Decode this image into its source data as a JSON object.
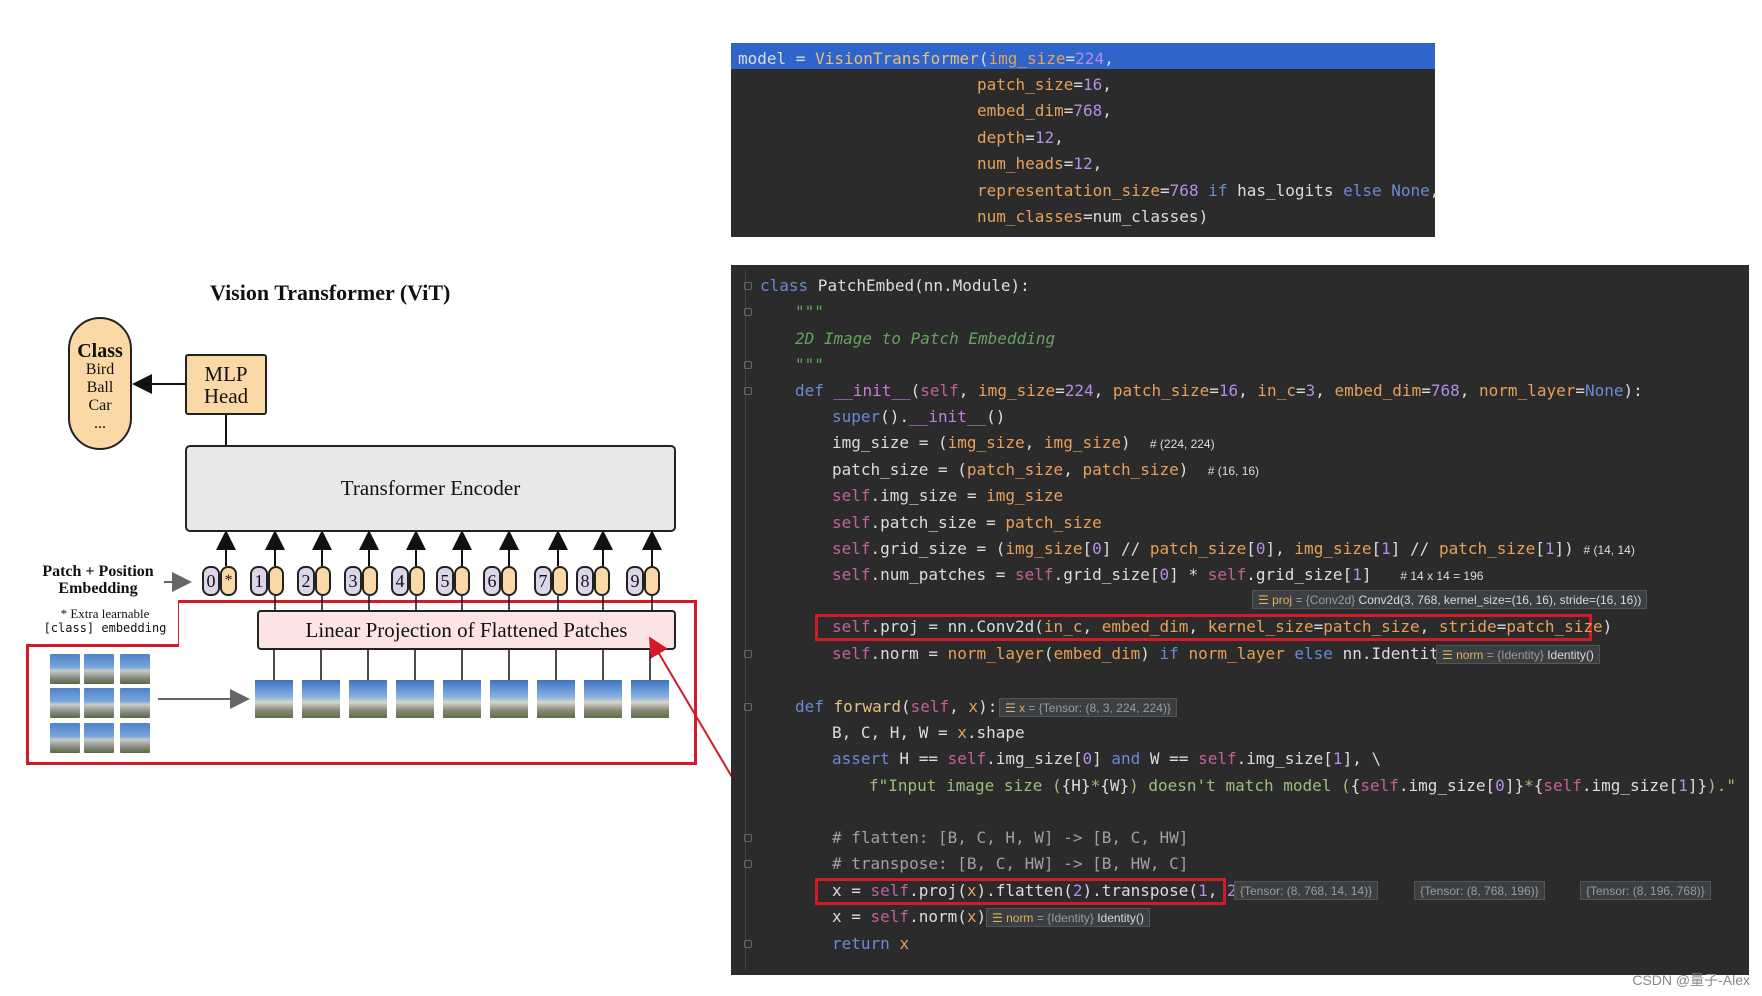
{
  "diagram": {
    "title": "Vision Transformer (ViT)",
    "class_box": {
      "header": "Class",
      "items": [
        "Bird",
        "Ball",
        "Car",
        "..."
      ]
    },
    "mlp_head": [
      "MLP",
      "Head"
    ],
    "encoder": "Transformer Encoder",
    "linear_projection": "Linear Projection of Flattened Patches",
    "patch_position_label": [
      "Patch + Position",
      "Embedding"
    ],
    "extra_note": [
      "* Extra learnable",
      "[class] embedding"
    ],
    "tokens": [
      "0",
      "1",
      "2",
      "3",
      "4",
      "5",
      "6",
      "7",
      "8",
      "9"
    ],
    "class_token_mark": "*"
  },
  "code_top": {
    "lines": [
      "model = VisionTransformer(img_size=224,",
      "                          patch_size=16,",
      "                          embed_dim=768,",
      "                          depth=12,",
      "                          num_heads=12,",
      "                          representation_size=768 if has_logits else None,",
      "                          num_classes=num_classes)"
    ]
  },
  "code_main": {
    "lines": [
      "class PatchEmbed(nn.Module):",
      "    \"\"\"",
      "    2D Image to Patch Embedding",
      "    \"\"\"",
      "    def __init__(self, img_size=224, patch_size=16, in_c=3, embed_dim=768, norm_layer=None):",
      "        super().__init__()",
      "        img_size = (img_size, img_size)",
      "        patch_size = (patch_size, patch_size)",
      "        self.img_size = img_size",
      "        self.patch_size = patch_size",
      "        self.grid_size = (img_size[0] // patch_size[0], img_size[1] // patch_size[1])",
      "        self.num_patches = self.grid_size[0] * self.grid_size[1]",
      "        self.proj = nn.Conv2d(in_c, embed_dim, kernel_size=patch_size, stride=patch_size)",
      "        self.norm = norm_layer(embed_dim) if norm_layer else nn.Identity()",
      "",
      "    def forward(self, x):",
      "        B, C, H, W = x.shape",
      "        assert H == self.img_size[0] and W == self.img_size[1], \\",
      "            f\"Input image size ({H}*{W}) doesn't match model ({self.img_size[0]}*{self.img_size[1]}).\"",
      "",
      "        # flatten: [B, C, H, W] -> [B, C, HW]",
      "        # transpose: [B, C, HW] -> [B, HW, C]",
      "        x = self.proj(x).flatten(2).transpose(1, 2)",
      "        x = self.norm(x)",
      "        return x"
    ],
    "comments": {
      "img_size": "# (224, 224)",
      "patch_size": "# (16, 16)",
      "grid_size": "# (14, 14)",
      "num_patches": "# 14 x 14 = 196"
    },
    "hints": {
      "proj": {
        "name": "proj",
        "type": "{Conv2d}",
        "value": "Conv2d(3, 768, kernel_size=(16, 16), stride=(16, 16))"
      },
      "norm_init": {
        "name": "norm",
        "type": "{Identity}",
        "value": "Identity()"
      },
      "x_forward": {
        "name": "x",
        "type": "{Tensor: (8, 3, 224, 224)}"
      },
      "norm_forward": {
        "name": "norm",
        "type": "{Identity}",
        "value": "Identity()"
      },
      "shapes": [
        "{Tensor: (8, 768, 14, 14)}",
        "{Tensor: (8, 768, 196)}",
        "{Tensor: (8, 196, 768)}"
      ]
    }
  },
  "watermark": "CSDN @量子-Alex",
  "colors": {
    "highlight_red": "#d11a2a",
    "editor_bg": "#2b2b2b",
    "selection_blue": "#2f65ca"
  }
}
